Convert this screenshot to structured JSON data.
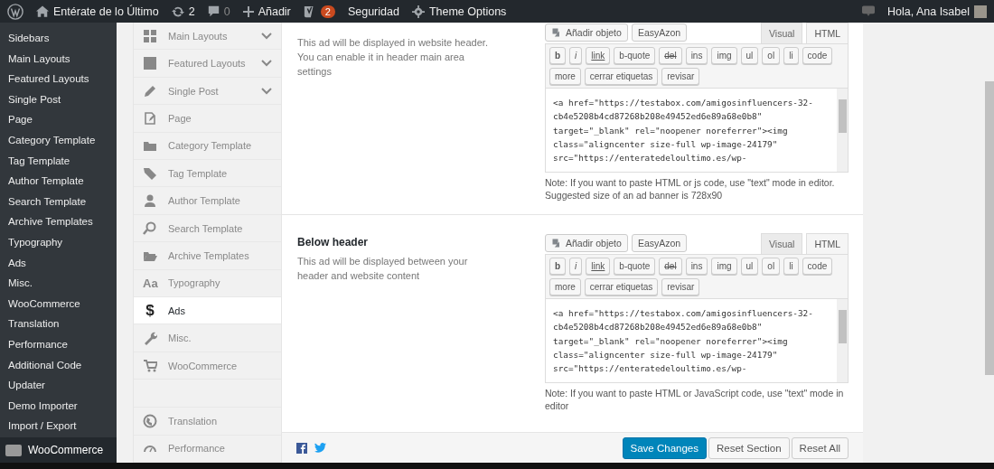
{
  "admin_bar": {
    "site_name": "Entérate de lo Último",
    "updates_count": "2",
    "comments_count": "0",
    "new_label": "Añadir",
    "seo_badge": "2",
    "security_label": "Seguridad",
    "theme_options_label": "Theme Options",
    "greeting": "Hola, Ana Isabel"
  },
  "admin_menu": {
    "items": [
      {
        "label": "Sidebars"
      },
      {
        "label": "Main Layouts"
      },
      {
        "label": "Featured Layouts"
      },
      {
        "label": "Single Post"
      },
      {
        "label": "Page"
      },
      {
        "label": "Category Template"
      },
      {
        "label": "Tag Template"
      },
      {
        "label": "Author Template"
      },
      {
        "label": "Search Template"
      },
      {
        "label": "Archive Templates"
      },
      {
        "label": "Typography"
      },
      {
        "label": "Ads"
      },
      {
        "label": "Misc."
      },
      {
        "label": "WooCommerce"
      },
      {
        "label": "Translation"
      },
      {
        "label": "Performance"
      },
      {
        "label": "Additional Code"
      },
      {
        "label": "Updater"
      },
      {
        "label": "Demo Importer"
      },
      {
        "label": "Import / Export"
      }
    ],
    "next_menu_label": "WooCommerce"
  },
  "options_nav": {
    "groups": [
      [
        {
          "label": "Main Layouts",
          "expandable": true,
          "selected": false
        },
        {
          "label": "Featured Layouts",
          "expandable": true,
          "selected": false
        },
        {
          "label": "Single Post",
          "expandable": true,
          "selected": false
        },
        {
          "label": "Page",
          "expandable": false,
          "selected": false
        },
        {
          "label": "Category Template",
          "expandable": false,
          "selected": false
        },
        {
          "label": "Tag Template",
          "expandable": false,
          "selected": false
        },
        {
          "label": "Author Template",
          "expandable": false,
          "selected": false
        },
        {
          "label": "Search Template",
          "expandable": false,
          "selected": false
        },
        {
          "label": "Archive Templates",
          "expandable": false,
          "selected": false
        },
        {
          "label": "Typography",
          "icon_text": "Aa",
          "expandable": false,
          "selected": false
        },
        {
          "label": "Ads",
          "icon_text": "$",
          "expandable": false,
          "selected": true
        },
        {
          "label": "Misc.",
          "expandable": false,
          "selected": false
        },
        {
          "label": "WooCommerce",
          "expandable": false,
          "selected": false
        }
      ],
      [
        {
          "label": "Translation",
          "expandable": false,
          "selected": false
        },
        {
          "label": "Performance",
          "expandable": false,
          "selected": false
        }
      ]
    ]
  },
  "sections": [
    {
      "description": "This ad will be displayed in website header. You can enable it in header main area settings",
      "editor": {
        "media_button": "Añadir objeto",
        "plugin_button": "EasyAzon",
        "tabs": [
          {
            "label": "Visual",
            "selected": false
          },
          {
            "label": "HTML",
            "selected": true
          }
        ],
        "quicktags": [
          {
            "label": "b",
            "kind": "bold"
          },
          {
            "label": "i",
            "kind": "italic"
          },
          {
            "label": "link",
            "kind": "underline"
          },
          {
            "label": "b-quote",
            "kind": "plain"
          },
          {
            "label": "del",
            "kind": "strike"
          },
          {
            "label": "ins",
            "kind": "plain"
          },
          {
            "label": "img",
            "kind": "plain"
          },
          {
            "label": "ul",
            "kind": "plain"
          },
          {
            "label": "ol",
            "kind": "plain"
          },
          {
            "label": "li",
            "kind": "plain"
          },
          {
            "label": "code",
            "kind": "plain"
          },
          {
            "label": "more",
            "kind": "plain"
          },
          {
            "label": "cerrar etiquetas",
            "kind": "plain"
          },
          {
            "label": "revisar",
            "kind": "plain"
          }
        ],
        "code_lines": [
          "<a href=\"https://testabox.com/amigosinfluencers-32-",
          "cb4e5208b4cd87268b208e49452ed6e89a68e0b8\"",
          "target=\"_blank\" rel=\"noopener noreferrer\"><img",
          "class=\"aligncenter size-full wp-image-24179\"",
          "src=\"https://enteratedeloultimo.es/wp-"
        ]
      },
      "note": "Note: If you want to paste HTML or js code, use \"text\" mode in editor. Suggested size of an ad banner is 728x90"
    },
    {
      "title": "Below header",
      "description": "This ad will be displayed between your header and website content",
      "editor": {
        "media_button": "Añadir objeto",
        "plugin_button": "EasyAzon",
        "tabs": [
          {
            "label": "Visual",
            "selected": false
          },
          {
            "label": "HTML",
            "selected": true
          }
        ],
        "quicktags": [
          {
            "label": "b",
            "kind": "bold"
          },
          {
            "label": "i",
            "kind": "italic"
          },
          {
            "label": "link",
            "kind": "underline"
          },
          {
            "label": "b-quote",
            "kind": "plain"
          },
          {
            "label": "del",
            "kind": "strike"
          },
          {
            "label": "ins",
            "kind": "plain"
          },
          {
            "label": "img",
            "kind": "plain"
          },
          {
            "label": "ul",
            "kind": "plain"
          },
          {
            "label": "ol",
            "kind": "plain"
          },
          {
            "label": "li",
            "kind": "plain"
          },
          {
            "label": "code",
            "kind": "plain"
          },
          {
            "label": "more",
            "kind": "plain"
          },
          {
            "label": "cerrar etiquetas",
            "kind": "plain"
          },
          {
            "label": "revisar",
            "kind": "plain"
          }
        ],
        "code_lines": [
          "<a href=\"https://testabox.com/amigosinfluencers-32-",
          "cb4e5208b4cd87268b208e49452ed6e89a68e0b8\"",
          "target=\"_blank\" rel=\"noopener noreferrer\"><img",
          "class=\"aligncenter size-full wp-image-24179\"",
          "src=\"https://enteratedeloultimo.es/wp-"
        ]
      },
      "note": "Note: If you want to paste HTML or JavaScript code, use \"text\" mode in editor"
    }
  ],
  "footer": {
    "buttons": [
      {
        "label": "Save Changes",
        "kind": "primary"
      },
      {
        "label": "Reset Section",
        "kind": "secondary"
      },
      {
        "label": "Reset All",
        "kind": "secondary"
      }
    ]
  }
}
